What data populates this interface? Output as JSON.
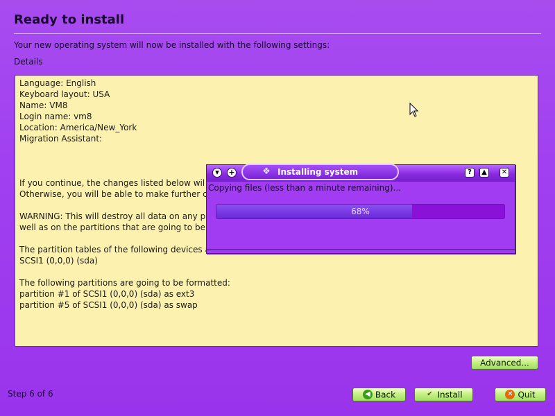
{
  "page": {
    "title": "Ready to install",
    "subtitle": "Your new operating system will now be installed with the following settings:",
    "details_label": "Details"
  },
  "details": {
    "lines": [
      "Language: English",
      "Keyboard layout: USA",
      "Name: VM8",
      "Login name: vm8",
      "Location: America/New_York",
      "Migration Assistant:",
      "",
      "",
      "",
      "If you continue, the changes listed below wil",
      "Otherwise, you will be able to make further c",
      "",
      "WARNING: This will destroy all data on any pa",
      "well as on the partitions that are going to be",
      "",
      "The partition tables of the following devices a",
      "SCSI1 (0,0,0) (sda)",
      "",
      "The following partitions are going to be formatted:",
      "partition #1 of SCSI1 (0,0,0) (sda) as ext3",
      "partition #5 of SCSI1 (0,0,0) (sda) as swap"
    ]
  },
  "dialog": {
    "title": "Installing system",
    "status": "Copying files (less than a minute remaining)...",
    "progress_label": "68%",
    "progress_fraction": 0.68,
    "controls_left": [
      "menu-icon",
      "sticky-icon"
    ],
    "controls_right": [
      "help-icon",
      "shade-icon",
      "close-icon"
    ]
  },
  "buttons": {
    "advanced": "Advanced...",
    "back": "Back",
    "install": "Install",
    "quit": "Quit"
  },
  "footer": {
    "step": "Step 6 of 6"
  },
  "colors": {
    "background": "#a040f0",
    "details_bg": "#fdf1b0",
    "button_green": "#c8f088",
    "progress_fill": "#7a3ae6",
    "progress_track": "#8a12d8"
  }
}
